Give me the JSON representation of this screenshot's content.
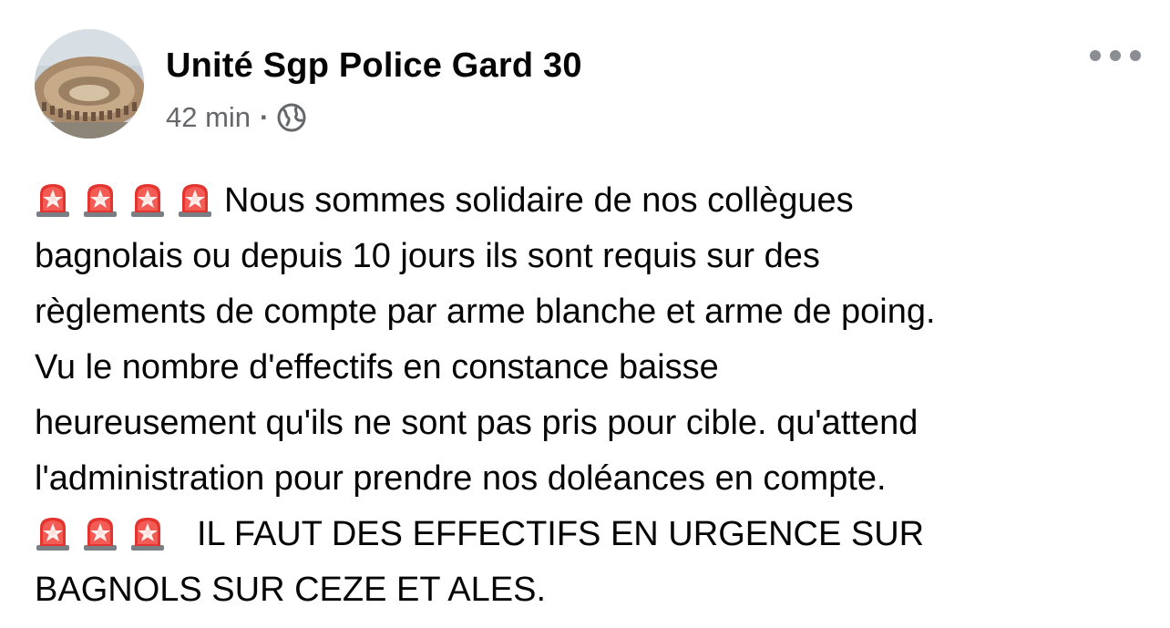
{
  "post": {
    "author": "Unité Sgp Police Gard 30",
    "time": "42 min",
    "separator": "·",
    "privacy_icon": "globe-icon",
    "more_icon": "more-options-icon",
    "paragraph1": {
      "emoji_count": 4,
      "emoji": "police-siren-light",
      "lines": [
        "Nous sommes solidaire de nos collègues",
        "bagnolais ou depuis 10 jours ils sont requis sur des",
        "règlements de compte par arme blanche et arme de poing.",
        "Vu le nombre d'effectifs en constance baisse",
        "heureusement qu'ils ne sont pas pris pour cible. qu'attend",
        "l'administration pour prendre nos doléances en compte."
      ]
    },
    "paragraph2": {
      "emoji_count": 3,
      "emoji": "police-siren-light",
      "lines": [
        "IL FAUT DES EFFECTIFS EN URGENCE SUR",
        "BAGNOLS SUR CEZE ET ALES."
      ]
    }
  }
}
